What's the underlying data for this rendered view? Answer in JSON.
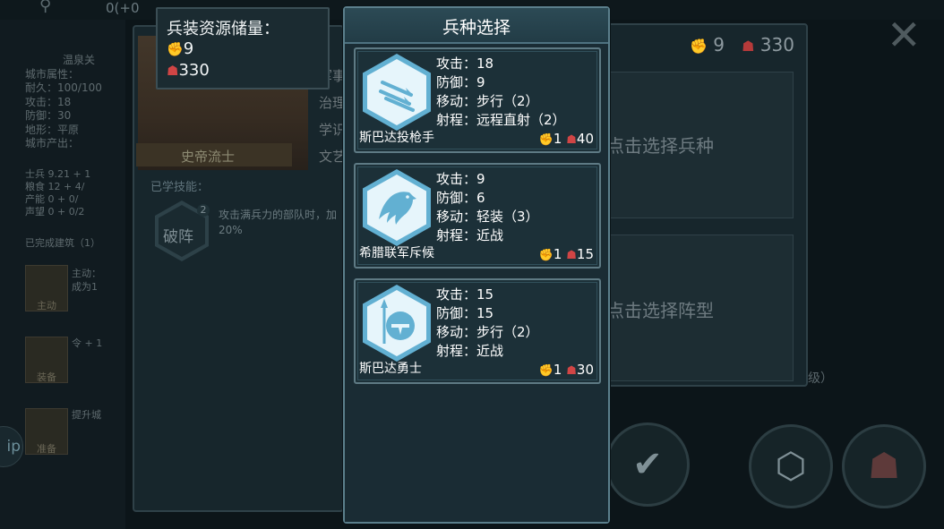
{
  "background": {
    "top_text": "0(+0",
    "city_name": "温泉关",
    "stats": [
      "城市属性：",
      "耐久：100/100",
      "攻击：18",
      "防御：30",
      "地形：平原",
      "城市产出："
    ],
    "resources": [
      "士兵 9.21 + 1",
      "粮食 12 + 4/",
      "产能 0 + 0/",
      "声望 0 + 0/2"
    ],
    "team_label": "已完成建筑（1）",
    "thumbs": [
      {
        "label": "主动",
        "text": [
          "主动：",
          "成为1"
        ]
      },
      {
        "label": "装备",
        "text": [
          "令 + 1"
        ]
      },
      {
        "label": "准备",
        "text": [
          "提升城"
        ]
      }
    ],
    "general_name": "史帝流士",
    "skills_label": "已学技能：",
    "skill_name": "破阵",
    "skill_level": "2",
    "skill_desc": "攻击满兵力的部队时，加20%",
    "mid_labels": [
      "军事",
      "治理",
      "学识",
      "文艺"
    ],
    "slot1_label": "点击选择兵种",
    "slot2_label": "点击选择阵型",
    "level_suffix": "级）",
    "top_res_troops": "9",
    "top_res_food": "330",
    "tip_label": "ip"
  },
  "storage": {
    "title": "兵装资源储量：",
    "troops": "9",
    "food": "330"
  },
  "modal": {
    "title": "兵种选择",
    "units": [
      {
        "name": "斯巴达投枪手",
        "icon": "javelin-icon",
        "attack": "攻击：18",
        "defense": "防御：9",
        "move": "移动：步行（2）",
        "range": "射程：远程直射（2）",
        "cost_troops": "1",
        "cost_food": "40"
      },
      {
        "name": "希腊联军斥候",
        "icon": "eagle-icon",
        "attack": "攻击：9",
        "defense": "防御：6",
        "move": "移动：轻装（3）",
        "range": "射程：近战",
        "cost_troops": "1",
        "cost_food": "15"
      },
      {
        "name": "斯巴达勇士",
        "icon": "spartan-shield-icon",
        "attack": "攻击：15",
        "defense": "防御：15",
        "move": "移动：步行（2）",
        "range": "射程：近战",
        "cost_troops": "1",
        "cost_food": "30"
      }
    ]
  },
  "colors": {
    "accent": "#62b0d2",
    "resource_icon": "#d04545",
    "modal_border": "#5b7f8c"
  }
}
